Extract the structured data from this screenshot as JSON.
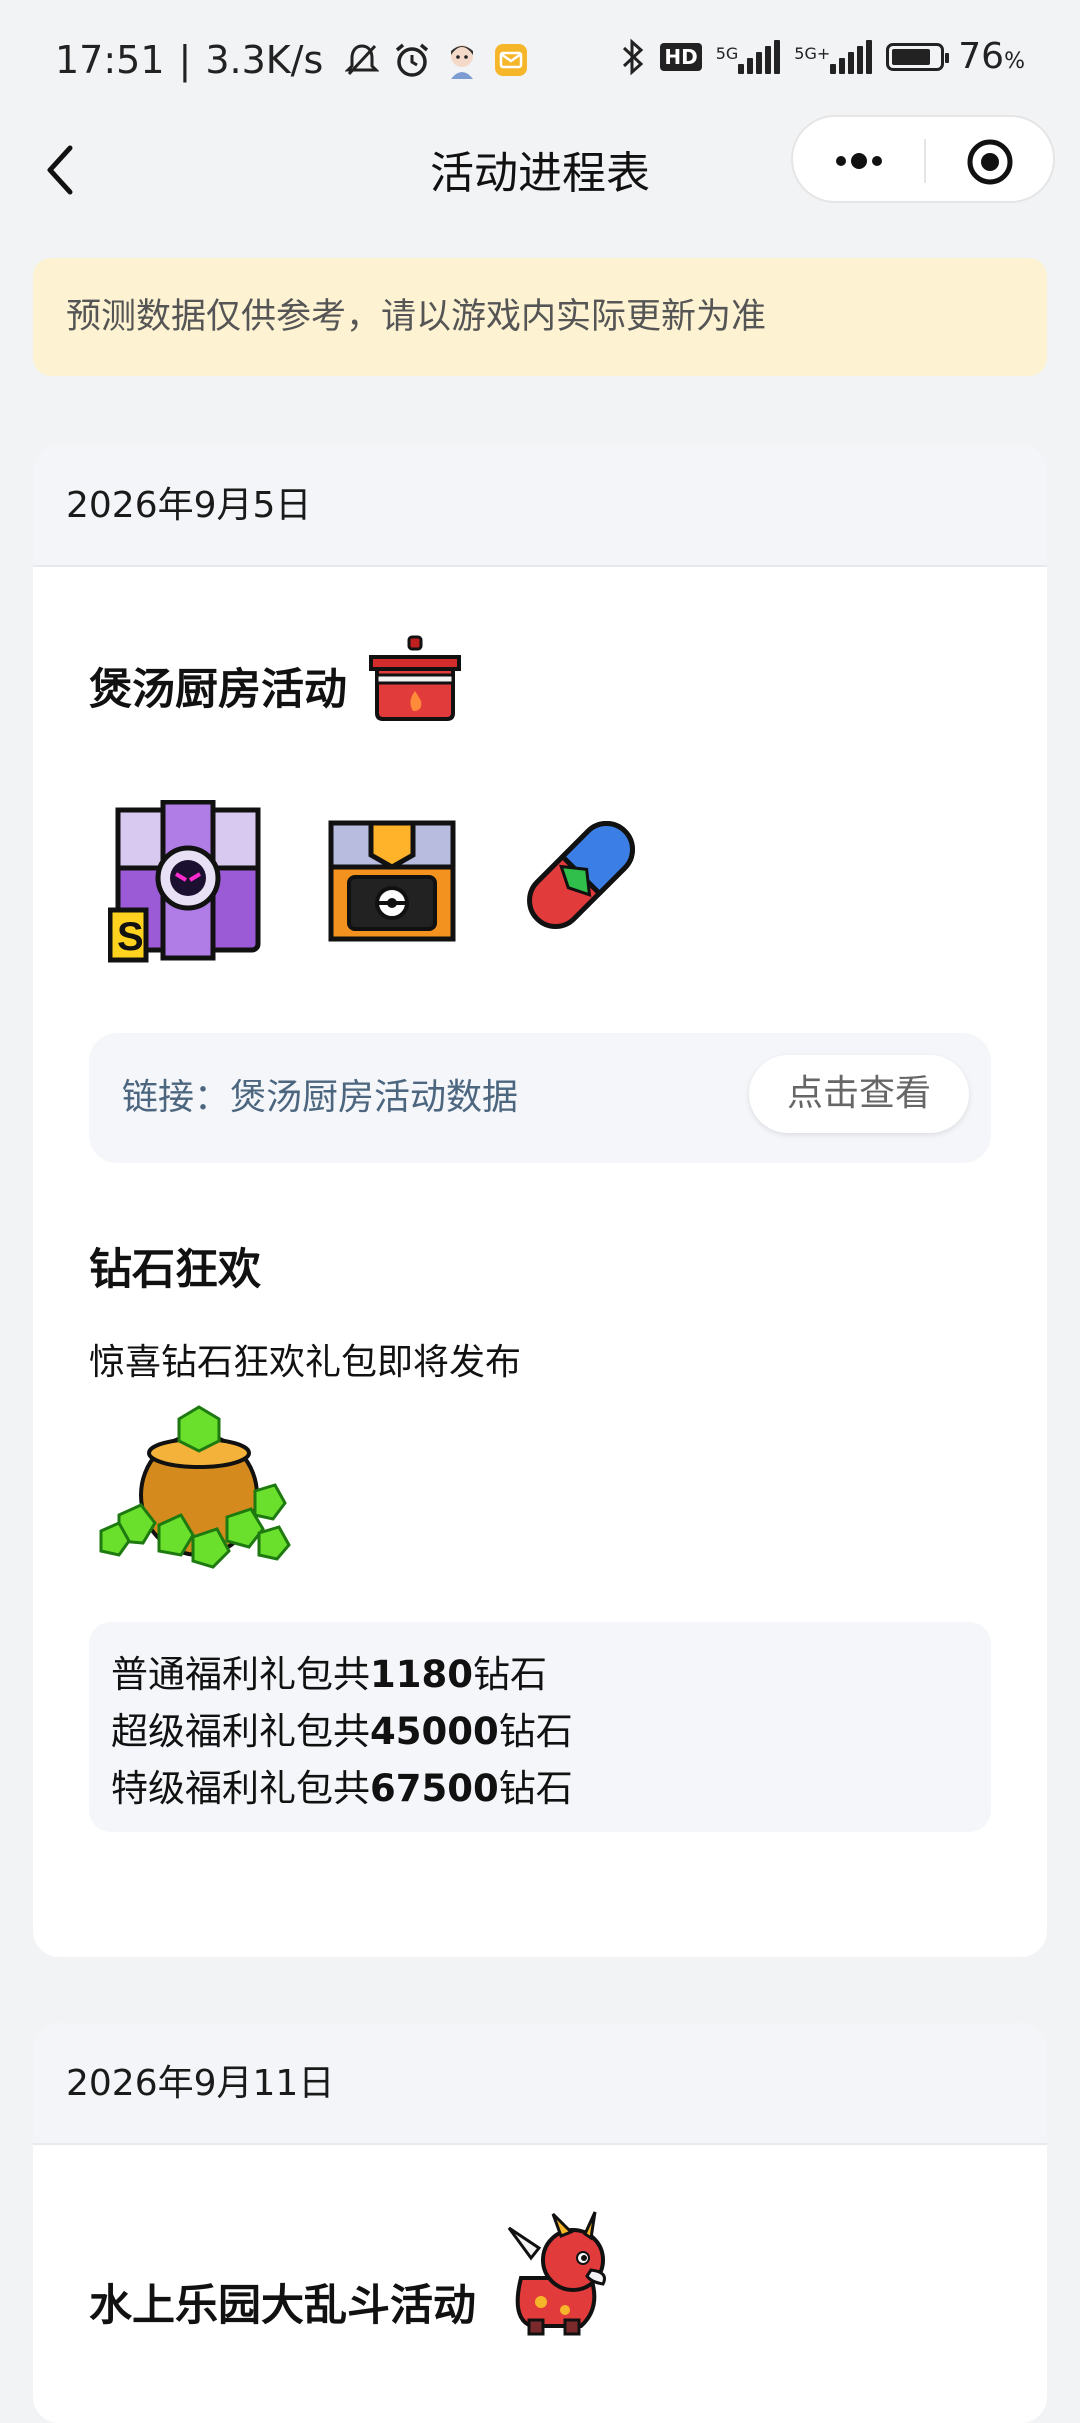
{
  "status_bar": {
    "time": "17:51",
    "speed": "3.3K/s",
    "network1": "5G",
    "network2": "5G+",
    "hd": "HD",
    "battery": "76",
    "battery_unit": "%",
    "icons": [
      "mute-bell-icon",
      "alarm-icon",
      "avatar-icon",
      "mail-app-icon",
      "bluetooth-icon"
    ]
  },
  "nav": {
    "title": "活动进程表",
    "back_icon": "chevron-left-icon",
    "more_icon": "more-dots-icon",
    "close_icon": "target-circle-icon"
  },
  "notice": {
    "text": "预测数据仅供参考，请以游戏内实际更新为准"
  },
  "cards": [
    {
      "date": "2026年9月5日",
      "sections": [
        {
          "title": "煲汤厨房活动",
          "title_icon": "red-pot-icon",
          "reward_icons": [
            "purple-s-box-icon",
            "orange-chest-icon",
            "blue-red-capsule-icon"
          ],
          "link_label": "链接：煲汤厨房活动数据",
          "link_button": "点击查看"
        },
        {
          "title": "钻石狂欢",
          "description": "惊喜钻石狂欢礼包即将发布",
          "image_icon": "gem-bag-icon",
          "packs": [
            {
              "prefix": "普通福利礼包共",
              "amount": "1180",
              "suffix": "钻石"
            },
            {
              "prefix": "超级福利礼包共",
              "amount": "45000",
              "suffix": "钻石"
            },
            {
              "prefix": "特级福利礼包共",
              "amount": "67500",
              "suffix": "钻石"
            }
          ]
        }
      ]
    },
    {
      "date": "2026年9月11日",
      "sections": [
        {
          "title": "水上乐园大乱斗活动",
          "title_icon": "red-dragon-icon"
        }
      ]
    }
  ],
  "colors": {
    "background": "#f2f3f5",
    "notice_bg": "#fdf3d3",
    "link_text": "#4c6680"
  }
}
